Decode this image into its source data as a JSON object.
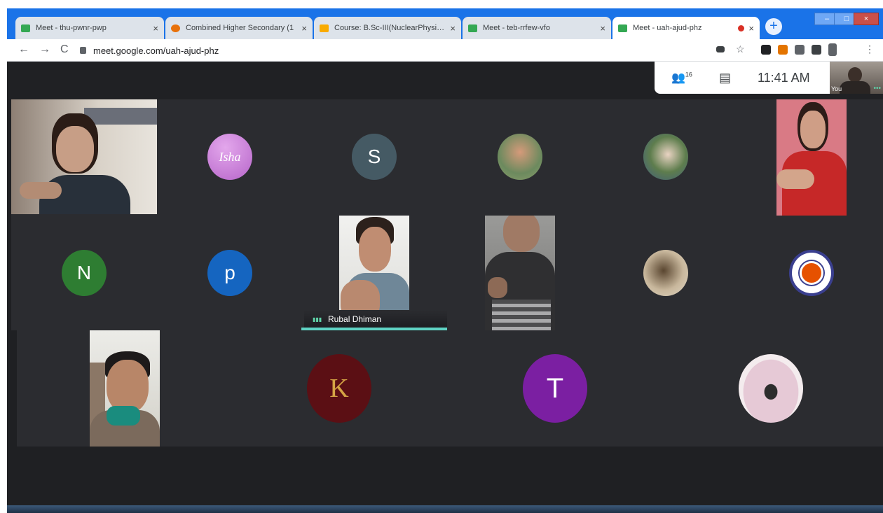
{
  "browser": {
    "tabs": [
      {
        "title": "Meet - thu-pwnr-pwp",
        "favicon": "google-meet-icon",
        "active": false
      },
      {
        "title": "Combined Higher Secondary (1",
        "favicon": "exam-site-icon",
        "active": false
      },
      {
        "title": "Course: B.Sc-III(NuclearPhysics)",
        "favicon": "moodle-icon",
        "active": false
      },
      {
        "title": "Meet - teb-rrfew-vfo",
        "favicon": "google-meet-icon",
        "active": false
      },
      {
        "title": "Meet - uah-ajud-phz",
        "favicon": "google-meet-icon",
        "active": true,
        "recording": true
      }
    ],
    "tab_close": "×",
    "new_tab": "+",
    "url": "meet.google.com/uah-ajud-phz"
  },
  "meet": {
    "participants_count": "16",
    "clock": "11:41 AM",
    "self_label": "You",
    "speaker_name": "Rubal Dhiman",
    "tiles": [
      {
        "kind": "avatar",
        "letter": "N",
        "color": "#2e7d32"
      },
      {
        "kind": "avatar",
        "letter": "p",
        "color": "#1565c0"
      },
      {
        "kind": "avatar",
        "letter": "S",
        "color": "#455a64"
      },
      {
        "kind": "avatar",
        "letter": "T",
        "color": "#7b1fa2"
      },
      {
        "kind": "avatar-image",
        "text": "Isha",
        "color": "#c57bd6"
      },
      {
        "kind": "avatar-image",
        "text": "K",
        "color": "#5b0f14"
      }
    ]
  },
  "colors": {
    "accent": "#1a73e8",
    "meet_bg": "#202124",
    "speaker": "#5fd3c4"
  }
}
